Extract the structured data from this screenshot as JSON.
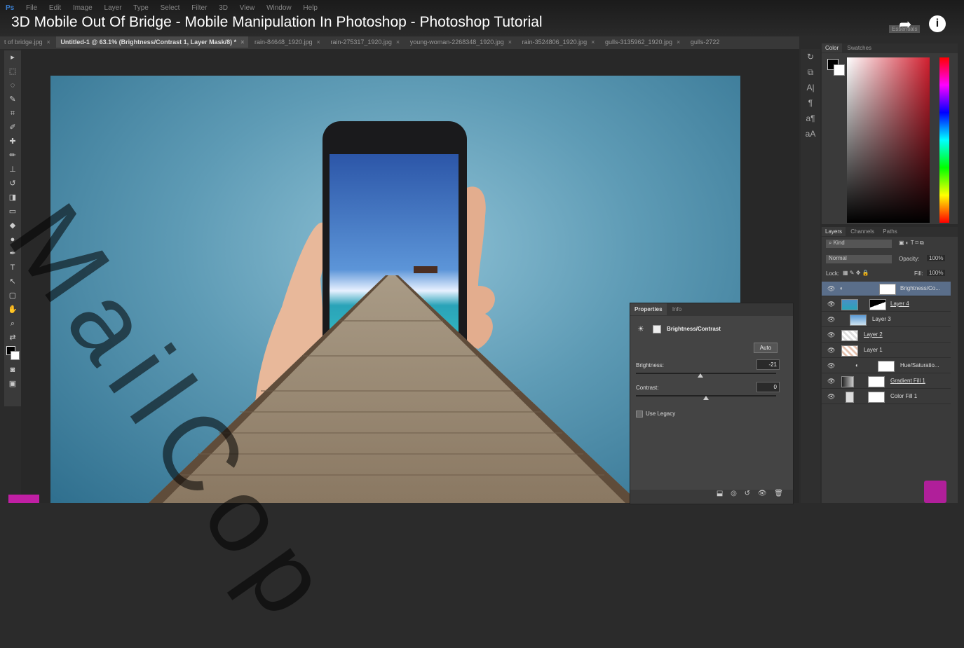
{
  "video": {
    "title": "3D Mobile Out Of Bridge - Mobile Manipulation In Photoshop - Photoshop Tutorial"
  },
  "app": {
    "logo": "Ps",
    "menu": [
      "File",
      "Edit",
      "Image",
      "Layer",
      "Type",
      "Select",
      "Filter",
      "3D",
      "View",
      "Window",
      "Help"
    ],
    "workspace": "Essentials"
  },
  "tabs": [
    {
      "label": "t of bridge.jpg",
      "close": "×",
      "active": false
    },
    {
      "label": "Untitled-1 @ 63.1% (Brightness/Contrast 1, Layer Mask/8) *",
      "close": "×",
      "active": true
    },
    {
      "label": "rain-84648_1920.jpg",
      "close": "×",
      "active": false
    },
    {
      "label": "rain-275317_1920.jpg",
      "close": "×",
      "active": false
    },
    {
      "label": "young-woman-2268348_1920.jpg",
      "close": "×",
      "active": false
    },
    {
      "label": "rain-3524806_1920.jpg",
      "close": "×",
      "active": false
    },
    {
      "label": "gulls-3135962_1920.jpg",
      "close": "×",
      "active": false
    },
    {
      "label": "gulls-2722",
      "close": "",
      "active": false
    }
  ],
  "color_panel": {
    "tabs": [
      "Color",
      "Swatches"
    ],
    "foreground": "#000000",
    "background": "#ffffff"
  },
  "layers_panel": {
    "tabs": [
      "Layers",
      "Channels",
      "Paths"
    ],
    "filter": "Kind",
    "blend_mode": "Normal",
    "opacity_label": "Opacity:",
    "opacity": "100%",
    "lock_label": "Lock:",
    "fill_label": "Fill:",
    "fill": "100%",
    "layers": [
      {
        "name": "Brightness/Co...",
        "selected": true
      },
      {
        "name": "Layer 4",
        "selected": false
      },
      {
        "name": "Layer 3",
        "selected": false
      },
      {
        "name": "Layer 2",
        "selected": false
      },
      {
        "name": "Layer 1",
        "selected": false
      },
      {
        "name": "Hue/Saturatio...",
        "selected": false
      },
      {
        "name": "Gradient Fill 1",
        "selected": false
      },
      {
        "name": "Color Fill 1",
        "selected": false
      }
    ]
  },
  "properties": {
    "tabs": [
      "Properties",
      "Info"
    ],
    "title": "Brightness/Contrast",
    "auto_label": "Auto",
    "brightness_label": "Brightness:",
    "brightness_value": "-21",
    "brightness_level": 0.46,
    "contrast_label": "Contrast:",
    "contrast_value": "0",
    "contrast_level": 0.5,
    "legacy_label": "Use Legacy"
  },
  "watermark": "MailCop"
}
